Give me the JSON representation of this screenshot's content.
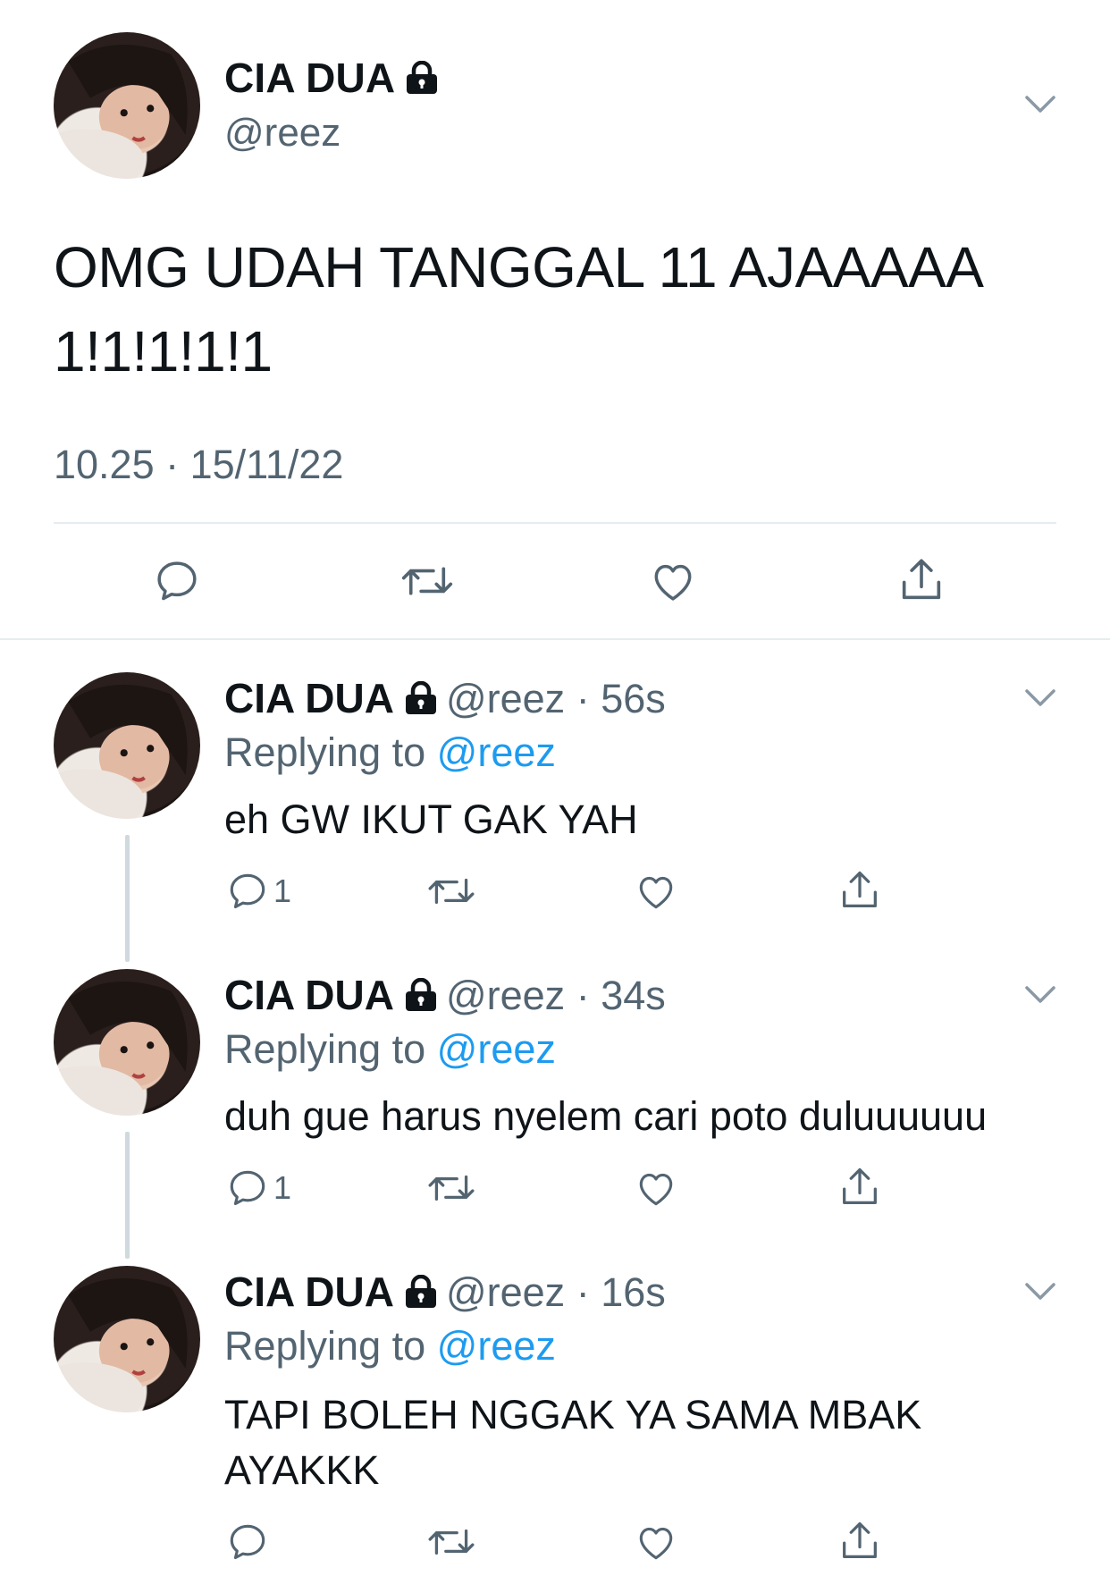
{
  "main_tweet": {
    "name": "CIA DUA",
    "handle": "@reez",
    "text": "OMG UDAH TANGGAL 11 AJAAAAA 1!1!1!1!1",
    "timestamp": "10.25 · 15/11/22",
    "icons": {
      "lock": "lock-icon",
      "menu": "chevron-down-icon",
      "reply": "reply-icon",
      "retweet": "retweet-icon",
      "like": "heart-icon",
      "share": "share-icon"
    }
  },
  "replies": [
    {
      "name": "CIA DUA",
      "handle": "@reez",
      "dot": "·",
      "age": "56s",
      "replying_label": "Replying to",
      "replying_to": "@reez",
      "text": "eh GW IKUT GAK YAH",
      "reply_count": "1"
    },
    {
      "name": "CIA DUA",
      "handle": "@reez",
      "dot": "·",
      "age": "34s",
      "replying_label": "Replying to",
      "replying_to": "@reez",
      "text": "duh gue harus nyelem cari poto duluuuuuu",
      "reply_count": "1"
    },
    {
      "name": "CIA DUA",
      "handle": "@reez",
      "dot": "·",
      "age": "16s",
      "replying_label": "Replying to",
      "replying_to": "@reez",
      "text": "TAPI BOLEH NGGAK YA SAMA MBAK AYAKKK",
      "reply_count": ""
    }
  ],
  "colors": {
    "text": "#0f1419",
    "secondary": "#536471",
    "accent": "#1d9bf0",
    "divider": "#e6ecf0"
  }
}
